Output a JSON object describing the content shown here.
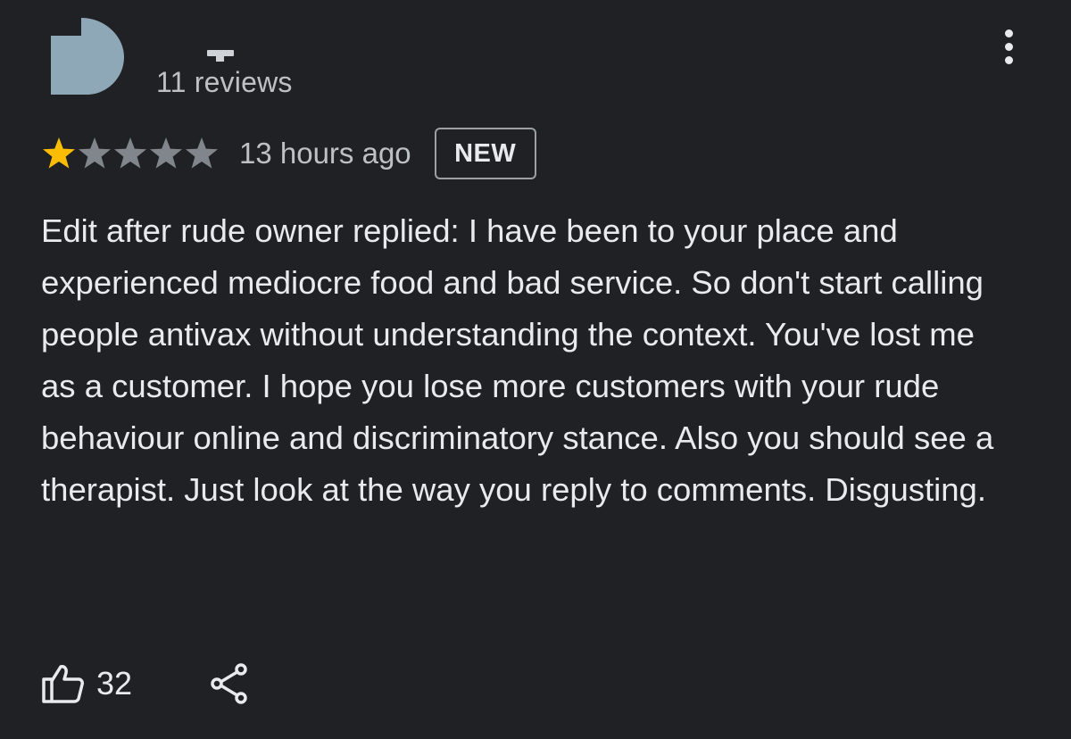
{
  "reviewer": {
    "reviews_count": "11 reviews",
    "avatar_color": "#8fa8b8"
  },
  "review": {
    "rating": 1,
    "max_rating": 5,
    "time": "13 hours ago",
    "badge": "NEW",
    "text": "Edit after rude owner replied: I have been to your place and experienced mediocre food and bad service. So don't start calling people antivax without understanding the context. You've lost me as a customer. I hope you lose more customers with your rude behaviour online and discriminatory stance. Also you should see a therapist. Just look at the way you reply to comments. Disgusting."
  },
  "actions": {
    "like_count": "32"
  },
  "colors": {
    "background": "#202124",
    "star_filled": "#fbbc04",
    "star_empty": "#80868b",
    "text_primary": "#e8eaed",
    "text_secondary": "#bdc1c6"
  },
  "icons": {
    "menu": "more-vert-icon",
    "like": "thumb-up-icon",
    "share": "share-icon"
  }
}
